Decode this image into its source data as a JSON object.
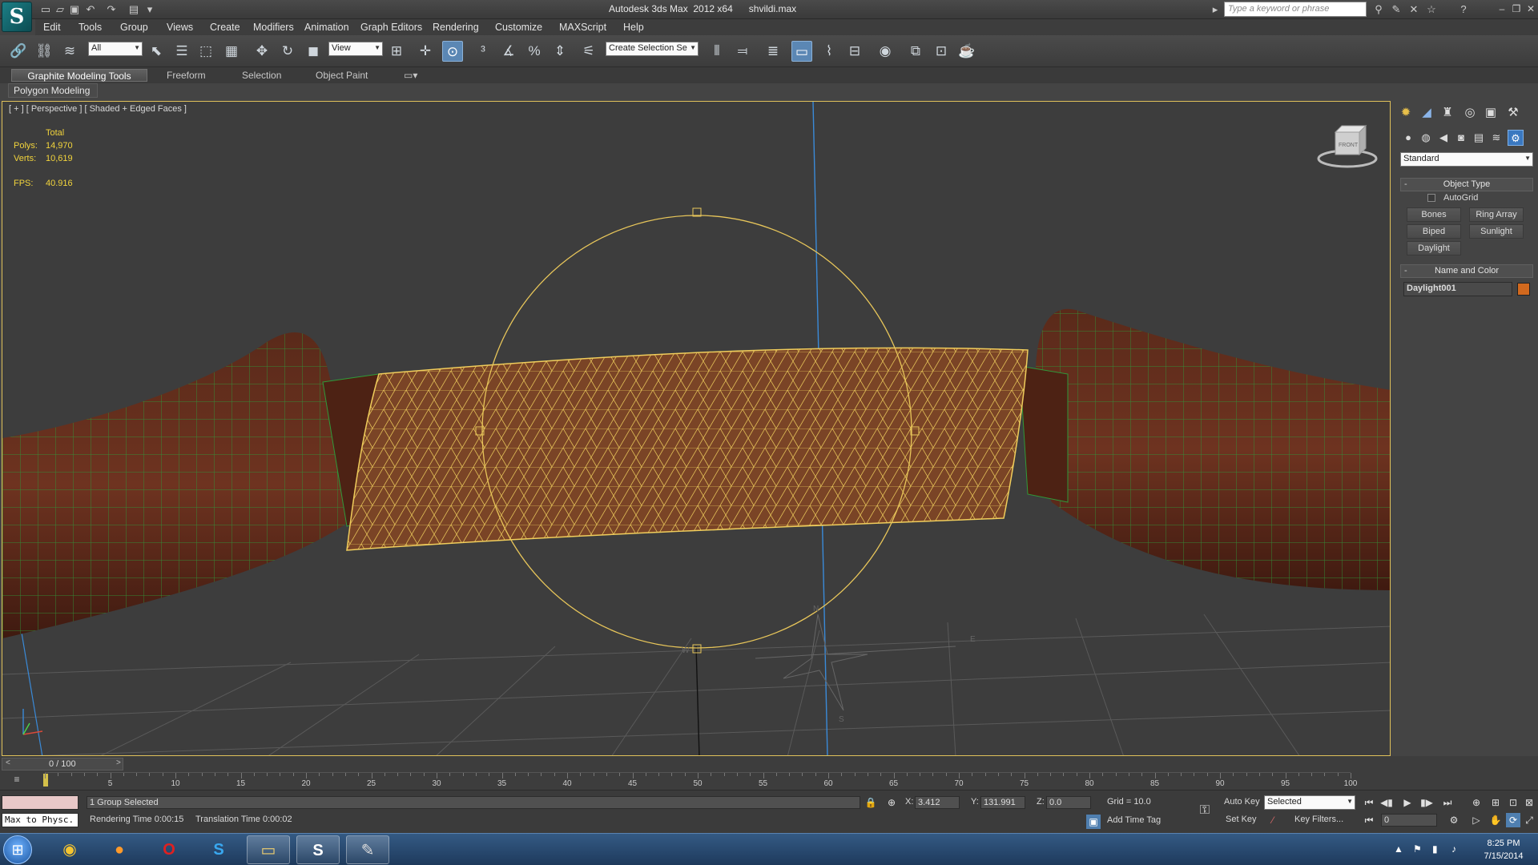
{
  "titlebar": {
    "app_logo": "S",
    "app_title": "Autodesk 3ds Max  2012 x64",
    "file_name": "shvildi.max",
    "search_placeholder": "Type a keyword or phrase"
  },
  "menu": [
    "Edit",
    "Tools",
    "Group",
    "Views",
    "Create",
    "Modifiers",
    "Animation",
    "Graph Editors",
    "Rendering",
    "Customize",
    "MAXScript",
    "Help"
  ],
  "toolbar": {
    "selection_filter": "All",
    "reference_coordinate": "View",
    "named_selection": "Create Selection Se"
  },
  "ribbon": {
    "tabs": [
      "Graphite Modeling Tools",
      "Freeform",
      "Selection",
      "Object Paint"
    ],
    "active_tab": "Graphite Modeling Tools",
    "panel": "Polygon Modeling"
  },
  "viewport": {
    "label": "[ + ] [ Perspective ] [ Shaded + Edged Faces ]",
    "stats": {
      "total_label": "Total",
      "polys_label": "Polys:",
      "polys_value": "14,970",
      "verts_label": "Verts:",
      "verts_value": "10,619",
      "fps_label": "FPS:",
      "fps_value": "40.916"
    },
    "viewcube_label": "FRONT",
    "compass_letters": [
      "N",
      "W",
      "E",
      "S"
    ]
  },
  "command_panel": {
    "category": "Standard",
    "object_type_title": "Object Type",
    "autogrid_label": "AutoGrid",
    "buttons": [
      "Bones",
      "Ring Array",
      "Biped",
      "Sunlight",
      "Daylight"
    ],
    "name_and_color_title": "Name and Color",
    "object_name": "Daylight001",
    "object_color": "#d2691e"
  },
  "timeline": {
    "frame_counter": "0 / 100",
    "ticks": [
      "5",
      "10",
      "15",
      "20",
      "25",
      "30",
      "35",
      "40",
      "45",
      "50",
      "55",
      "60",
      "65",
      "70",
      "75",
      "80",
      "85",
      "90",
      "95",
      "100"
    ]
  },
  "status": {
    "listener_text": "Max to Physc.",
    "selection_status": "1 Group Selected",
    "rendering_time": "Rendering Time  0:00:15",
    "translation_time": "Translation Time  0:00:02",
    "x_label": "X:",
    "x_value": "3.412",
    "y_label": "Y:",
    "y_value": "131.991",
    "z_label": "Z:",
    "z_value": "0.0",
    "grid": "Grid = 10.0",
    "add_time_tag": "Add Time Tag",
    "auto_key": "Auto Key",
    "set_key": "Set Key",
    "key_mode": "Selected",
    "key_filters": "Key Filters...",
    "current_frame": "0"
  },
  "taskbar": {
    "time": "8:25 PM",
    "date": "7/15/2014"
  },
  "colors": {
    "accent_blue": "#5b87b4",
    "viewport_border": "#e0c15a",
    "stat_yellow": "#f2d43c"
  }
}
